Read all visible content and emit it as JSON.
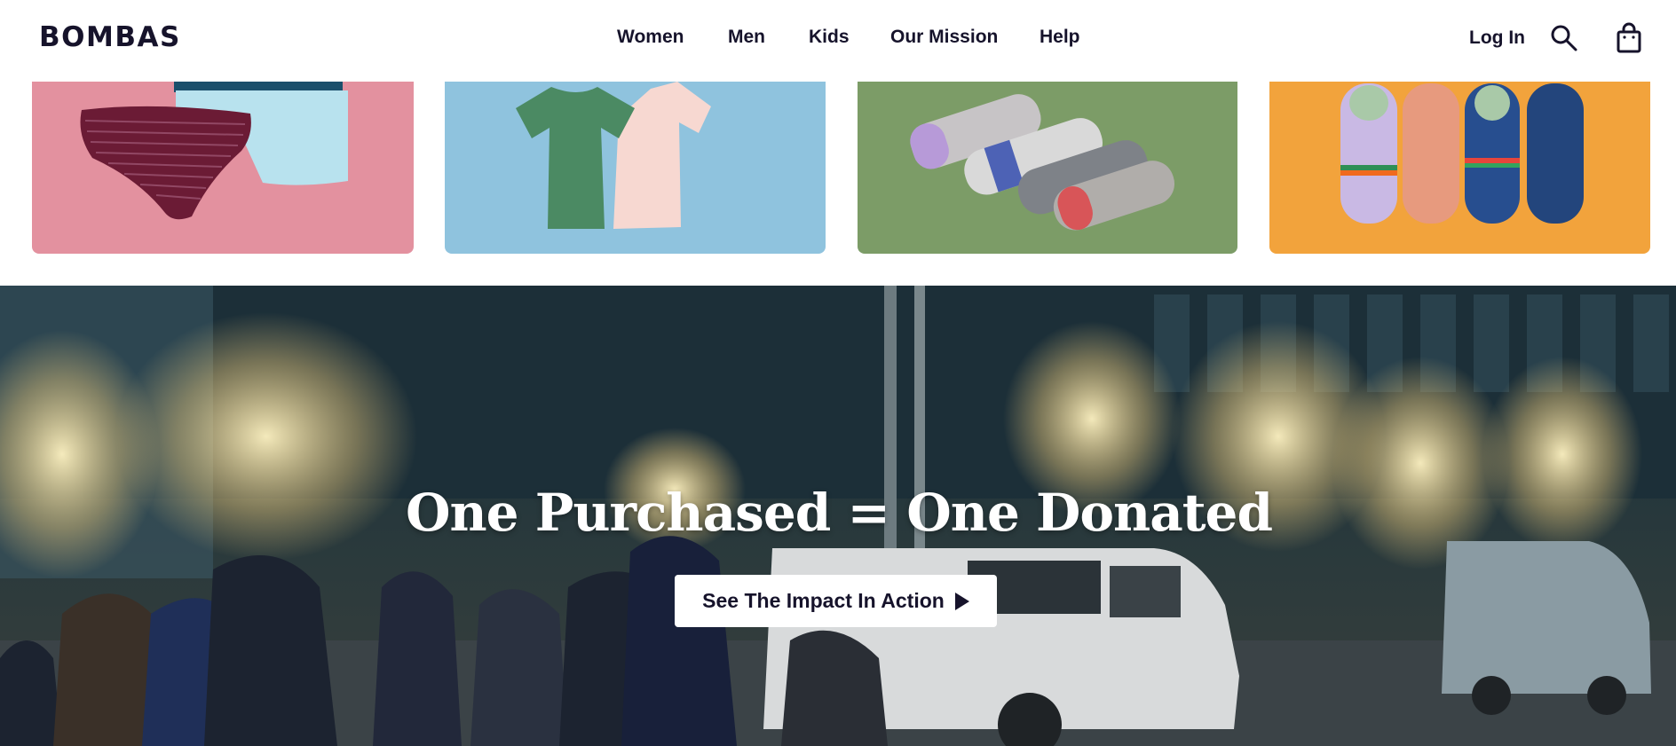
{
  "brand": {
    "logo_text": "BOMBAS"
  },
  "nav": {
    "items": [
      "Women",
      "Men",
      "Kids",
      "Our Mission",
      "Help"
    ]
  },
  "header": {
    "login_label": "Log In",
    "search_icon": "search-icon",
    "bag_icon": "shopping-bag-icon"
  },
  "tiles": [
    {
      "name": "underwear",
      "bg": "#e3919f"
    },
    {
      "name": "t-shirts",
      "bg": "#8fc3de"
    },
    {
      "name": "socks",
      "bg": "#7c9c67"
    },
    {
      "name": "slippers",
      "bg": "#f2a33c"
    }
  ],
  "hero": {
    "title": "One Purchased = One Donated",
    "cta_label": "See The Impact In Action",
    "cta_icon": "play-icon"
  }
}
